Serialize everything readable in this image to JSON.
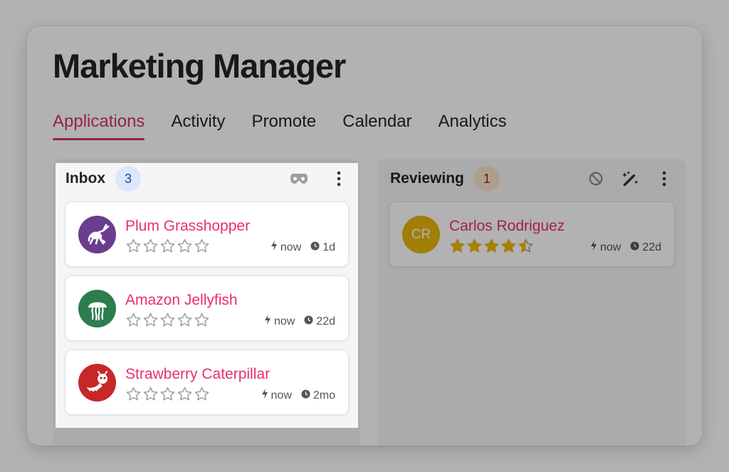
{
  "app": {
    "title": "Marketing Manager"
  },
  "tabs": [
    {
      "label": "Applications",
      "active": true
    },
    {
      "label": "Activity",
      "active": false
    },
    {
      "label": "Promote",
      "active": false
    },
    {
      "label": "Calendar",
      "active": false
    },
    {
      "label": "Analytics",
      "active": false
    }
  ],
  "colors": {
    "accent": "#d6336c",
    "name_pink": "#e8306b",
    "star_gold": "#f0b90b"
  },
  "columns": {
    "inbox": {
      "title": "Inbox",
      "count": "3",
      "icons": [
        "incognito-mask-icon",
        "more-vertical-icon"
      ],
      "cards": [
        {
          "name": "Plum Grasshopper",
          "avatar_icon": "grasshopper-icon",
          "avatar_color": "#6a3d8f",
          "rating": 0,
          "activity": "now",
          "age": "1d"
        },
        {
          "name": "Amazon Jellyfish",
          "avatar_icon": "jellyfish-icon",
          "avatar_color": "#2e7d4f",
          "rating": 0,
          "activity": "now",
          "age": "22d"
        },
        {
          "name": "Strawberry Caterpillar",
          "avatar_icon": "caterpillar-icon",
          "avatar_color": "#c62828",
          "rating": 0,
          "activity": "now",
          "age": "2mo"
        }
      ]
    },
    "reviewing": {
      "title": "Reviewing",
      "count": "1",
      "icons": [
        "block-icon",
        "magic-wand-icon",
        "more-vertical-icon"
      ],
      "cards": [
        {
          "name": "Carlos Rodriguez",
          "initials": "CR",
          "avatar_color": "#e5b50b",
          "rating": 4.5,
          "activity": "now",
          "age": "22d"
        }
      ]
    }
  }
}
